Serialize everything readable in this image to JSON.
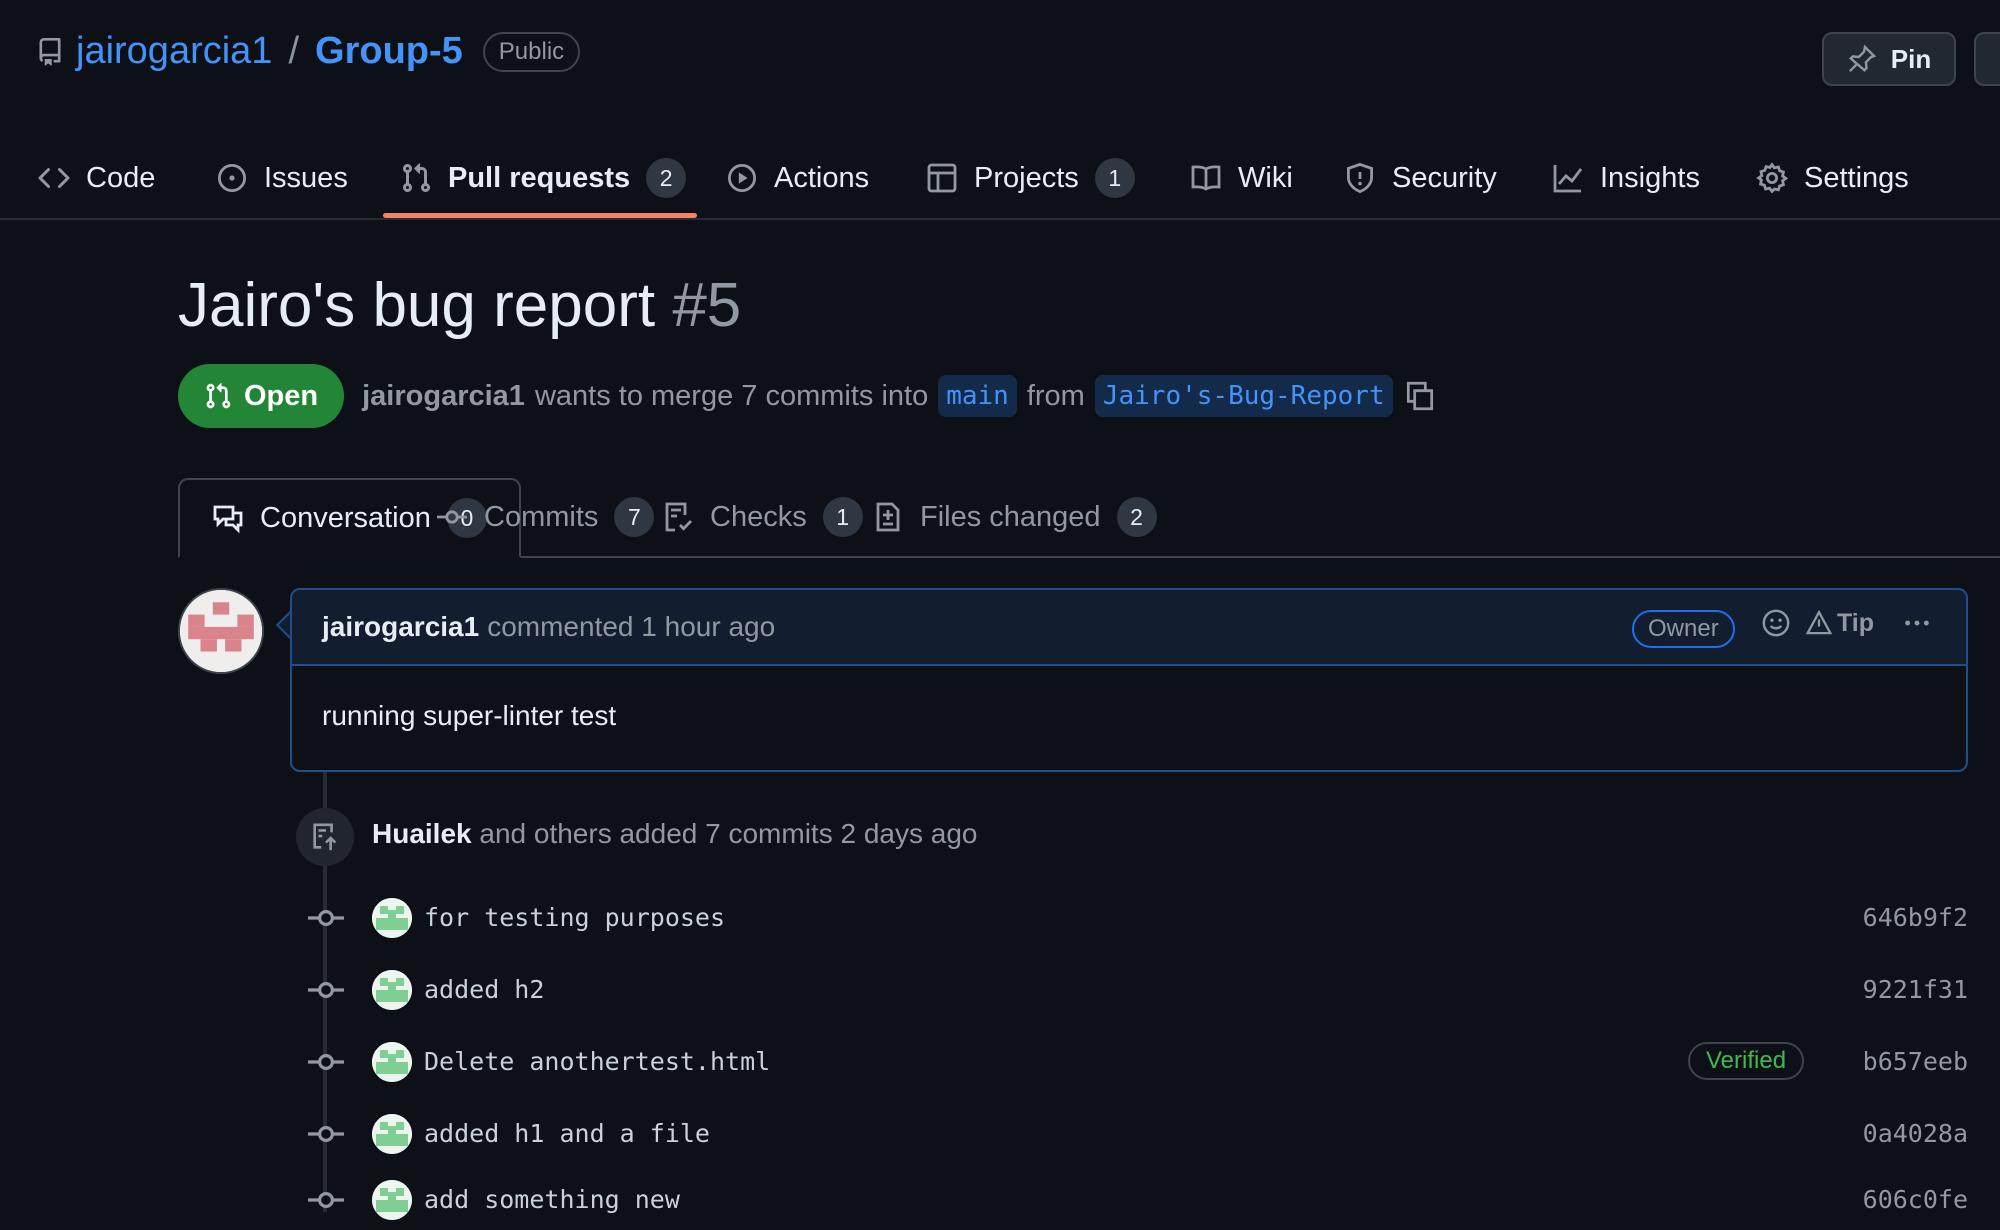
{
  "repo": {
    "owner": "jairogarcia1",
    "separator": "/",
    "name": "Group-5",
    "visibility": "Public",
    "pin_label": "Pin"
  },
  "nav": {
    "code": "Code",
    "issues": "Issues",
    "pull_requests": "Pull requests",
    "pull_requests_count": "2",
    "actions": "Actions",
    "projects": "Projects",
    "projects_count": "1",
    "wiki": "Wiki",
    "security": "Security",
    "insights": "Insights",
    "settings": "Settings"
  },
  "pr": {
    "title": "Jairo's bug report",
    "number": "#5",
    "state": "Open",
    "author": "jairogarcia1",
    "merge_text": "wants to merge 7 commits into",
    "base_branch": "main",
    "from_text": "from",
    "head_branch": "Jairo's-Bug-Report"
  },
  "tabs": {
    "conversation": "Conversation",
    "conversation_count": "0",
    "commits": "Commits",
    "commits_count": "7",
    "checks": "Checks",
    "checks_count": "1",
    "files": "Files changed",
    "files_count": "2"
  },
  "comment": {
    "author": "jairogarcia1",
    "meta": "commented 1 hour ago",
    "role_badge": "Owner",
    "tip_label": "Tip",
    "body": "running super-linter test"
  },
  "timeline": {
    "actor": "Huailek",
    "summary": "and others added 7 commits 2 days ago",
    "commits": [
      {
        "message": "for testing purposes",
        "sha": "646b9f2",
        "verified": ""
      },
      {
        "message": "added h2",
        "sha": "9221f31",
        "verified": ""
      },
      {
        "message": "Delete anothertest.html",
        "sha": "b657eeb",
        "verified": "Verified"
      },
      {
        "message": "added h1 and a file",
        "sha": "0a4028a",
        "verified": ""
      },
      {
        "message": "add something new",
        "sha": "606c0fe",
        "verified": ""
      }
    ]
  },
  "colors": {
    "background": "#0d1117",
    "link": "#4493f8",
    "open_green": "#238636",
    "active_tab_underline": "#f78166",
    "verified_green": "#3fb950"
  }
}
